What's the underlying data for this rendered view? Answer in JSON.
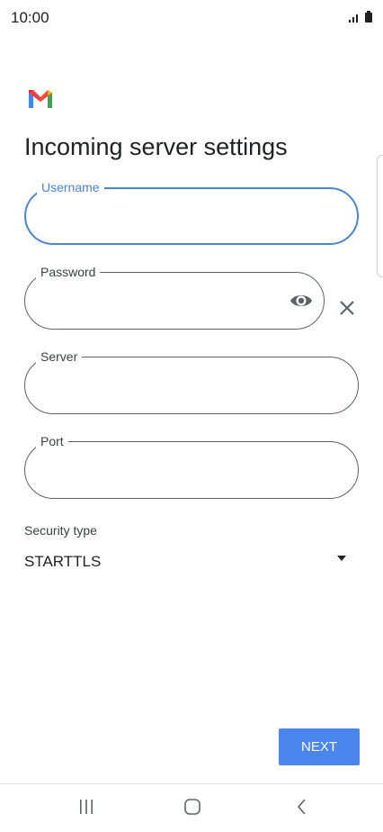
{
  "status_bar": {
    "time": "10:00",
    "signal_icon": "signal-icon",
    "battery_icon": "battery-icon"
  },
  "app": {
    "logo_icon": "gmail-logo"
  },
  "page": {
    "title": "Incoming server settings"
  },
  "fields": {
    "username": {
      "label": "Username",
      "value": ""
    },
    "password": {
      "label": "Password",
      "value": "",
      "toggle_icon": "eye-icon",
      "clear_icon": "close-icon"
    },
    "server": {
      "label": "Server",
      "value": ""
    },
    "port": {
      "label": "Port",
      "value": ""
    }
  },
  "security": {
    "label": "Security type",
    "selected": "STARTTLS",
    "arrow_icon": "dropdown-arrow-icon"
  },
  "actions": {
    "next_label": "NEXT",
    "accent_color": "#4a86ee"
  },
  "nav_bar": {
    "recent_icon": "recent-apps-icon",
    "home_icon": "home-icon",
    "back_icon": "back-icon"
  }
}
